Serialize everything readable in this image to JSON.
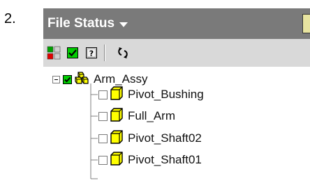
{
  "step_number": "2.",
  "panel": {
    "title": "File Status",
    "title_dropdown_icon": "caret-down-icon",
    "header_color": "#7a7a7a"
  },
  "toolbar": {
    "buttons": [
      {
        "name": "status-colors-toggle",
        "icon": "color-grid-icon"
      },
      {
        "name": "show-checked-toggle",
        "icon": "checkbox-check-icon"
      },
      {
        "name": "unknown-status-toggle",
        "icon": "question-box-icon"
      },
      {
        "name": "refresh-button",
        "icon": "refresh-arrows-icon"
      }
    ]
  },
  "tree": {
    "root": {
      "label": "Arm_Assy",
      "checked": true,
      "expanded": true,
      "icon": "assembly-icon"
    },
    "children": [
      {
        "label": "Pivot_Bushing",
        "checked": false,
        "icon": "part-icon"
      },
      {
        "label": "Full_Arm",
        "checked": false,
        "icon": "part-icon"
      },
      {
        "label": "Pivot_Shaft02",
        "checked": false,
        "icon": "part-icon"
      },
      {
        "label": "Pivot_Shaft01",
        "checked": false,
        "icon": "part-icon"
      }
    ]
  },
  "colors": {
    "check_green": "#00cc00",
    "part_yellow": "#ffff00"
  }
}
